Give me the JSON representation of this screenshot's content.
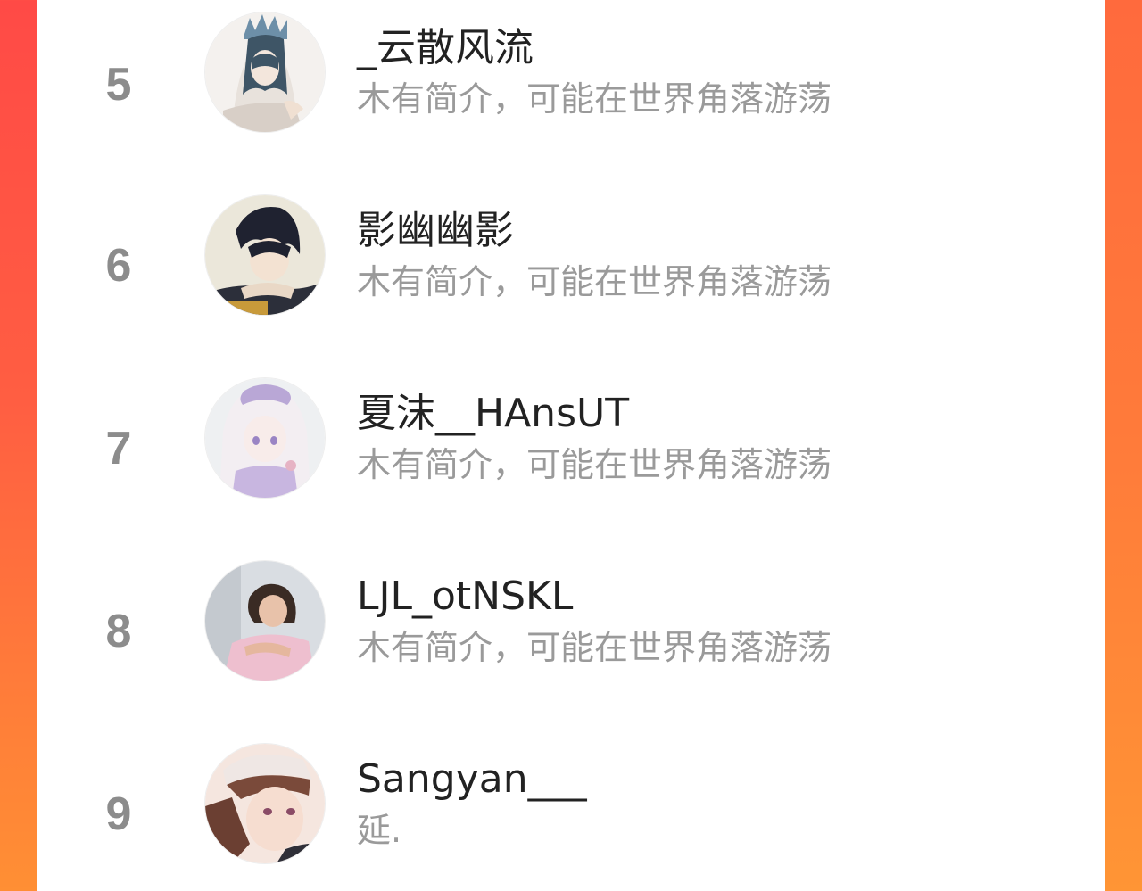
{
  "colors": {
    "background_accent": "#ff5a44",
    "panel": "#ffffff",
    "rank_text": "#8c8c8c",
    "name_text": "#222222",
    "bio_text": "#9a9a9a"
  },
  "ranking": {
    "items": [
      {
        "rank": "5",
        "name": "_云散风流",
        "bio": "木有简介，可能在世界角落游荡",
        "avatar_icon": "avatar-anime-crowned-girl"
      },
      {
        "rank": "6",
        "name": "影幽幽影",
        "bio": "木有简介，可能在世界角落游荡",
        "avatar_icon": "avatar-anime-dark-haired-boy"
      },
      {
        "rank": "7",
        "name": "夏沫__HAnsUT",
        "bio": "木有简介，可能在世界角落游荡",
        "avatar_icon": "avatar-anime-lavender-girl"
      },
      {
        "rank": "8",
        "name": "LJL_otNSKL",
        "bio": "木有简介，可能在世界角落游荡",
        "avatar_icon": "avatar-child-photo"
      },
      {
        "rank": "9",
        "name": "Sangyan___",
        "bio": "延.",
        "avatar_icon": "avatar-anime-man-cap"
      }
    ]
  }
}
